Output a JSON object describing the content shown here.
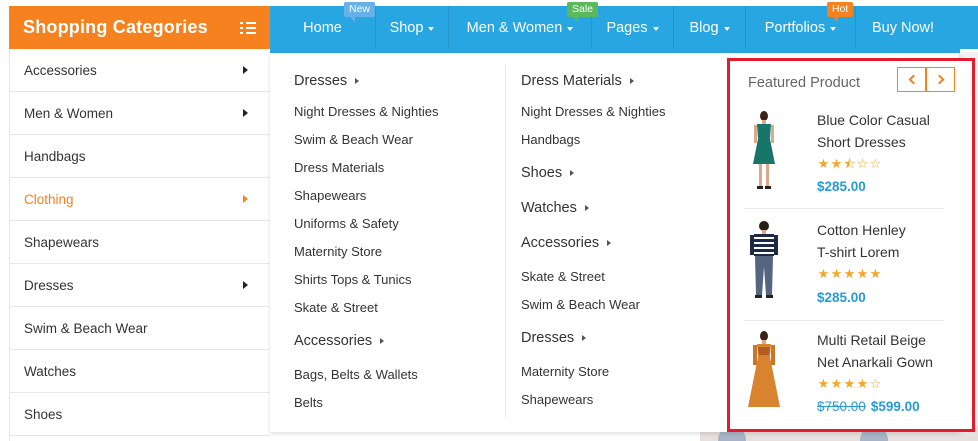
{
  "category_header": {
    "title": "Shopping Categories",
    "icon": "list-icon"
  },
  "nav": {
    "items": [
      {
        "label": "Home",
        "tag": "New"
      },
      {
        "label": "Shop",
        "tag": ""
      },
      {
        "label": "Men & Women",
        "tag": "Sale"
      },
      {
        "label": "Pages",
        "tag": ""
      },
      {
        "label": "Blog",
        "tag": ""
      },
      {
        "label": "Portfolios",
        "tag": "Hot"
      },
      {
        "label": "Buy Now!",
        "tag": ""
      }
    ]
  },
  "sidebar": {
    "items": [
      {
        "label": "Accessories",
        "has_arrow": true
      },
      {
        "label": "Men & Women",
        "has_arrow": true
      },
      {
        "label": "Handbags",
        "has_arrow": false
      },
      {
        "label": "Clothing",
        "has_arrow": true,
        "active": true
      },
      {
        "label": "Shapewears",
        "has_arrow": false
      },
      {
        "label": "Dresses",
        "has_arrow": true
      },
      {
        "label": "Swim & Beach Wear",
        "has_arrow": false
      },
      {
        "label": "Watches",
        "has_arrow": false
      },
      {
        "label": "Shoes",
        "has_arrow": false
      }
    ]
  },
  "mega": {
    "col1": {
      "dresses_title": "Dresses",
      "dresses_links": [
        "Night Dresses & Nighties",
        "Swim & Beach Wear",
        "Dress Materials",
        "Shapewears",
        "Uniforms & Safety",
        "Maternity Store",
        "Shirts Tops & Tunics",
        "Skate & Street"
      ],
      "accessories_title": "Accessories",
      "accessories_links": [
        "Bags, Belts & Wallets",
        "Belts"
      ]
    },
    "col2": {
      "dress_materials_title": "Dress Materials",
      "dress_materials_links": [
        "Night Dresses & Nighties",
        "Handbags"
      ],
      "shoes_title": "Shoes",
      "watches_title": "Watches",
      "accessories_title": "Accessories",
      "accessories_links": [
        "Skate & Street",
        "Swim & Beach Wear"
      ],
      "dresses_title": "Dresses",
      "dresses_links": [
        "Maternity Store",
        "Shapewears"
      ]
    }
  },
  "featured": {
    "title": "Featured Product",
    "products": [
      {
        "name_line1": "Blue Color Casual",
        "name_line2": "Short Dresses",
        "rating": 2.5,
        "price": "$285.00",
        "old_price": ""
      },
      {
        "name_line1": "Cotton Henley",
        "name_line2": "T-shirt Lorem",
        "rating": 5,
        "price": "$285.00",
        "old_price": ""
      },
      {
        "name_line1": "Multi Retail Beige",
        "name_line2": "Net Anarkali Gown",
        "rating": 4,
        "price": "$599.00",
        "old_price": "$750.00"
      }
    ]
  },
  "colors": {
    "orange": "#f5811f",
    "blue": "#27a6e1",
    "highlight": "#e21b2d",
    "price": "#2a9ad6"
  }
}
